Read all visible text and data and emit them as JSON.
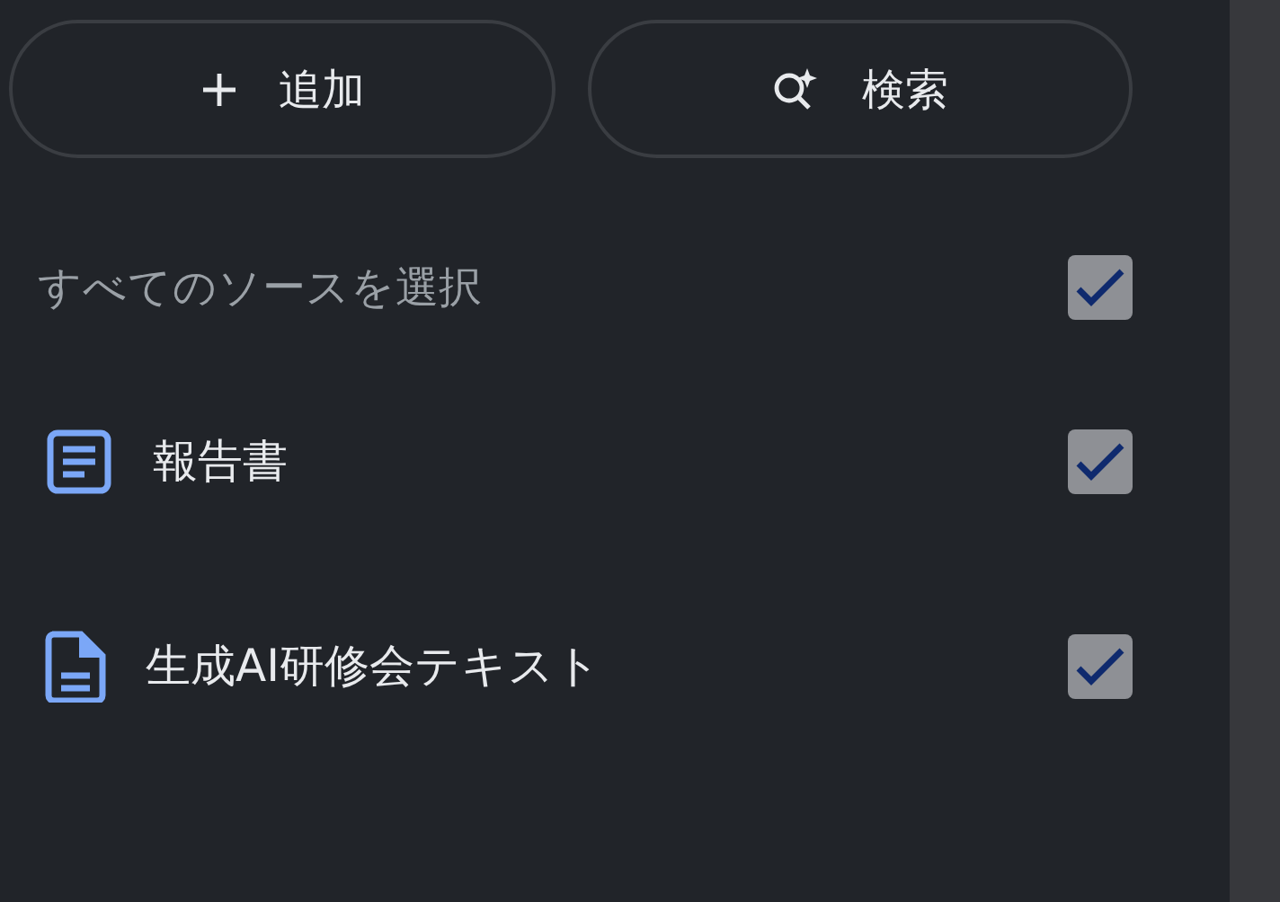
{
  "buttons": [
    {
      "kind": "add",
      "label": "追加"
    },
    {
      "kind": "search",
      "label": "検索"
    }
  ],
  "select_all": {
    "label": "すべてのソースを選択",
    "checked": true
  },
  "sources": [
    {
      "kind": "text",
      "title": "報告書",
      "checked": true
    },
    {
      "kind": "document",
      "title": "生成AI研修会テキスト",
      "checked": true
    }
  ]
}
